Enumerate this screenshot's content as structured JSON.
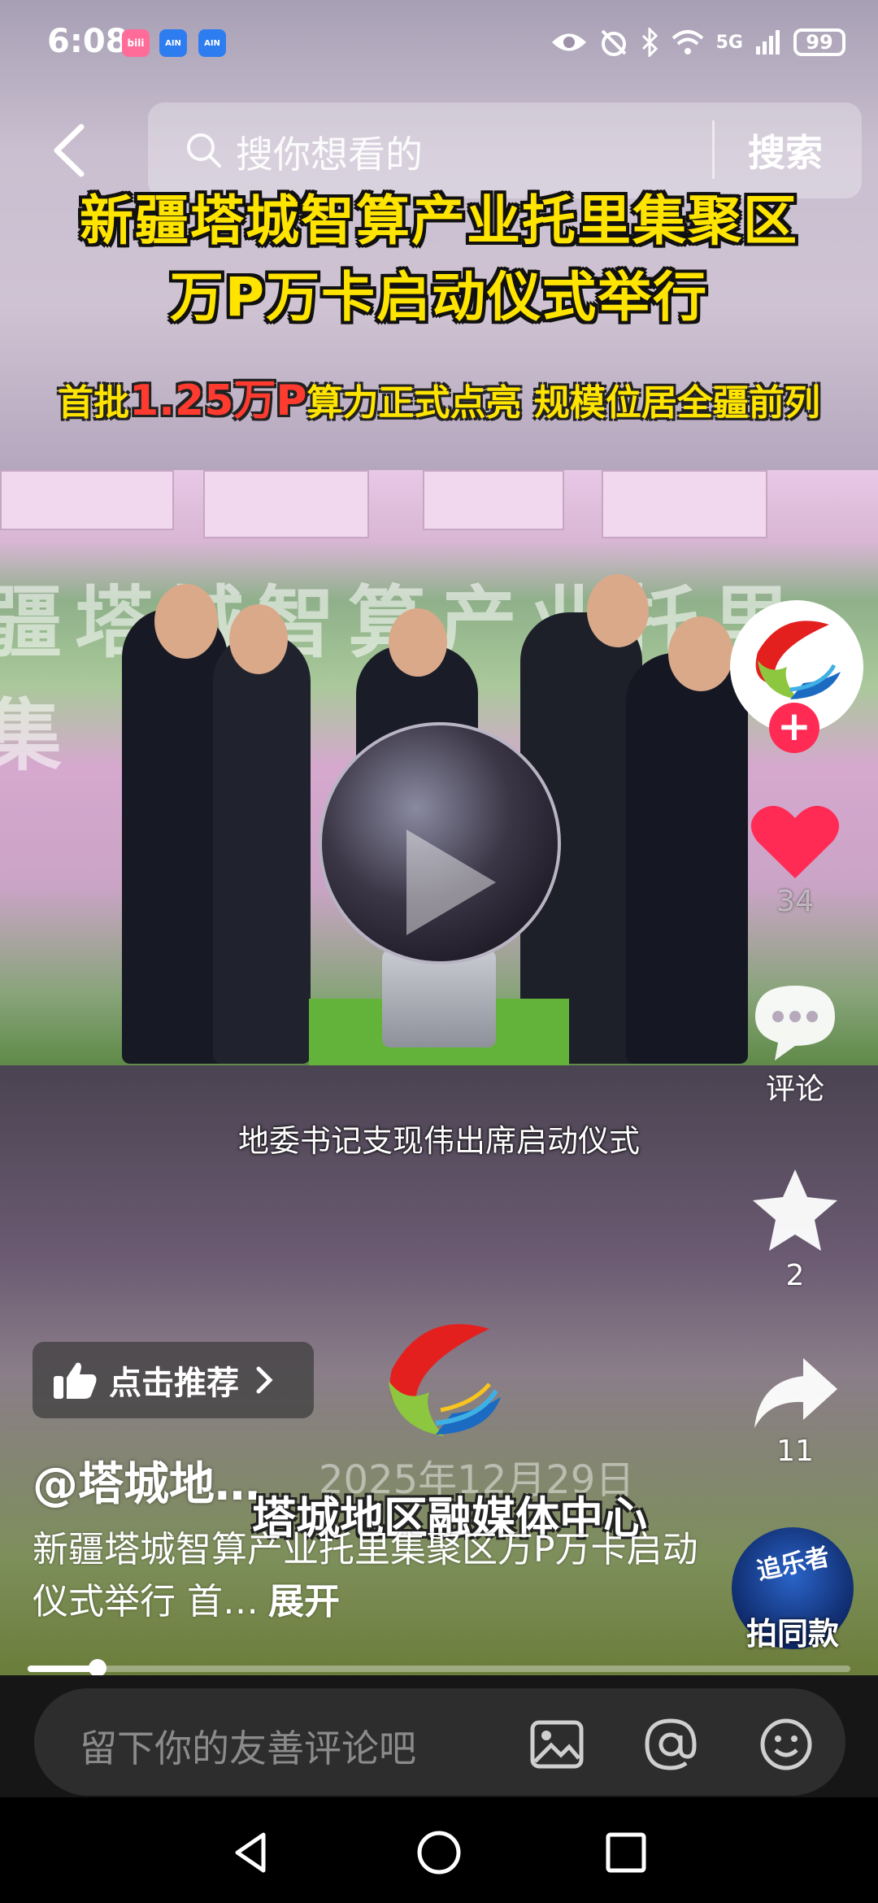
{
  "status_bar": {
    "time": "6:08",
    "app_badges": [
      "bilibili",
      "AIN",
      "AIN"
    ],
    "network": "5G",
    "battery": "99"
  },
  "search": {
    "placeholder": "搜你想看的",
    "button_label": "搜索"
  },
  "video": {
    "headline_line1": "新疆塔城智算产业托里集聚区",
    "headline_line2": "万P万卡启动仪式举行",
    "subheadline_prefix": "首批",
    "subheadline_highlight": "1.25万P",
    "subheadline_suffix": "算力正式点亮  规模位居全疆前列",
    "caption": "地委书记支现伟出席启动仪式",
    "date_watermark": "2025年12月29日",
    "org_watermark": "塔城地区融媒体中心",
    "progress_percent": 8.5
  },
  "right_rail": {
    "like_count": "34",
    "comment_label": "评论",
    "favorite_count": "2",
    "share_count": "11",
    "same_style_title": "追乐者",
    "same_style_label": "拍同款"
  },
  "post": {
    "recommend_label": "点击推荐",
    "author": "@塔城地…",
    "description": "新疆塔城智算产业托里集聚区万P万卡启动仪式举行 首…",
    "expand_label": "展开"
  },
  "comment_bar": {
    "placeholder": "留下你的友善评论吧"
  },
  "colors": {
    "headline_yellow": "#ffe400",
    "highlight_red": "#ff3b30",
    "like_red": "#ff2b55",
    "follow_pink": "#ff2b55"
  }
}
